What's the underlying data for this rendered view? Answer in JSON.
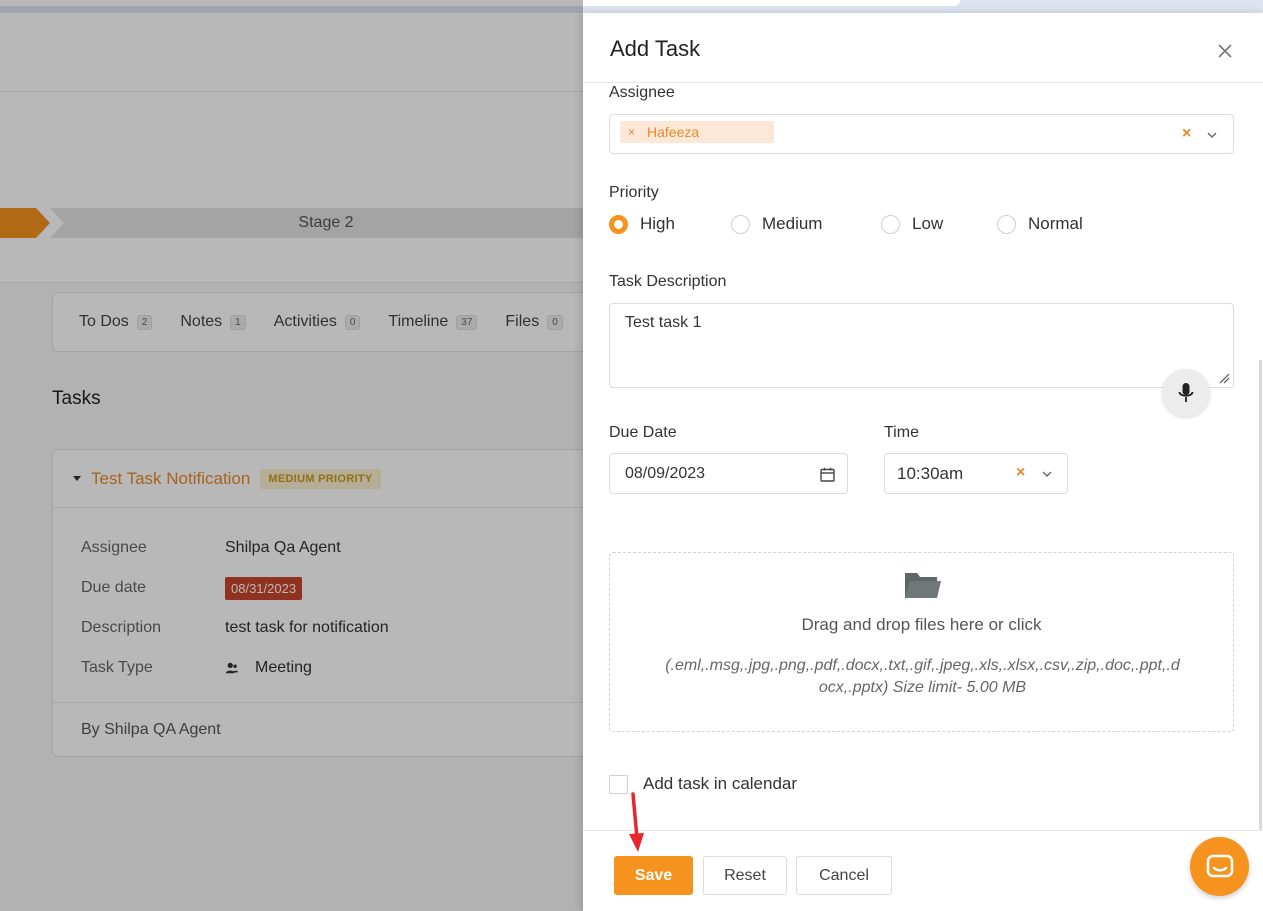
{
  "background": {
    "stage": {
      "label": "Stage 2"
    },
    "tabs": [
      {
        "label": "To Dos",
        "count": "2"
      },
      {
        "label": "Notes",
        "count": "1"
      },
      {
        "label": "Activities",
        "count": "0"
      },
      {
        "label": "Timeline",
        "count": "37"
      },
      {
        "label": "Files",
        "count": "0"
      }
    ],
    "tasks_heading": "Tasks",
    "task": {
      "name": "Test Task Notification",
      "priority_badge": "MEDIUM PRIORITY",
      "rows": [
        {
          "key": "Assignee",
          "value": "Shilpa Qa Agent"
        },
        {
          "key": "Due date",
          "value": "08/31/2023"
        },
        {
          "key": "Description",
          "value": "test task for notification"
        },
        {
          "key": "Task Type",
          "value": "Meeting"
        }
      ],
      "footer": "By Shilpa QA Agent"
    }
  },
  "drawer": {
    "title": "Add Task",
    "assignee": {
      "label": "Assignee",
      "chips": [
        "Hafeeza"
      ]
    },
    "priority": {
      "label": "Priority",
      "options": [
        "High",
        "Medium",
        "Low",
        "Normal"
      ],
      "selected": "High"
    },
    "description": {
      "label": "Task Description",
      "value": "Test task 1"
    },
    "due_date": {
      "label": "Due Date",
      "value": "08/09/2023"
    },
    "time": {
      "label": "Time",
      "value": "10:30am"
    },
    "dropzone": {
      "text": "Drag and drop files here or click",
      "types": "(.eml,.msg,.jpg,.png,.pdf,.docx,.txt,.gif,.jpeg,.xls,.xlsx,.csv,.zip,.doc,.ppt,.docx,.pptx) Size limit- 5.00 MB"
    },
    "calendar_checkbox": {
      "label": "Add task in calendar",
      "checked": false
    },
    "buttons": {
      "save": "Save",
      "reset": "Reset",
      "cancel": "Cancel"
    }
  },
  "colors": {
    "accent": "#f6921e",
    "danger": "#c9442c",
    "annotation_arrow": "#e8262c"
  }
}
